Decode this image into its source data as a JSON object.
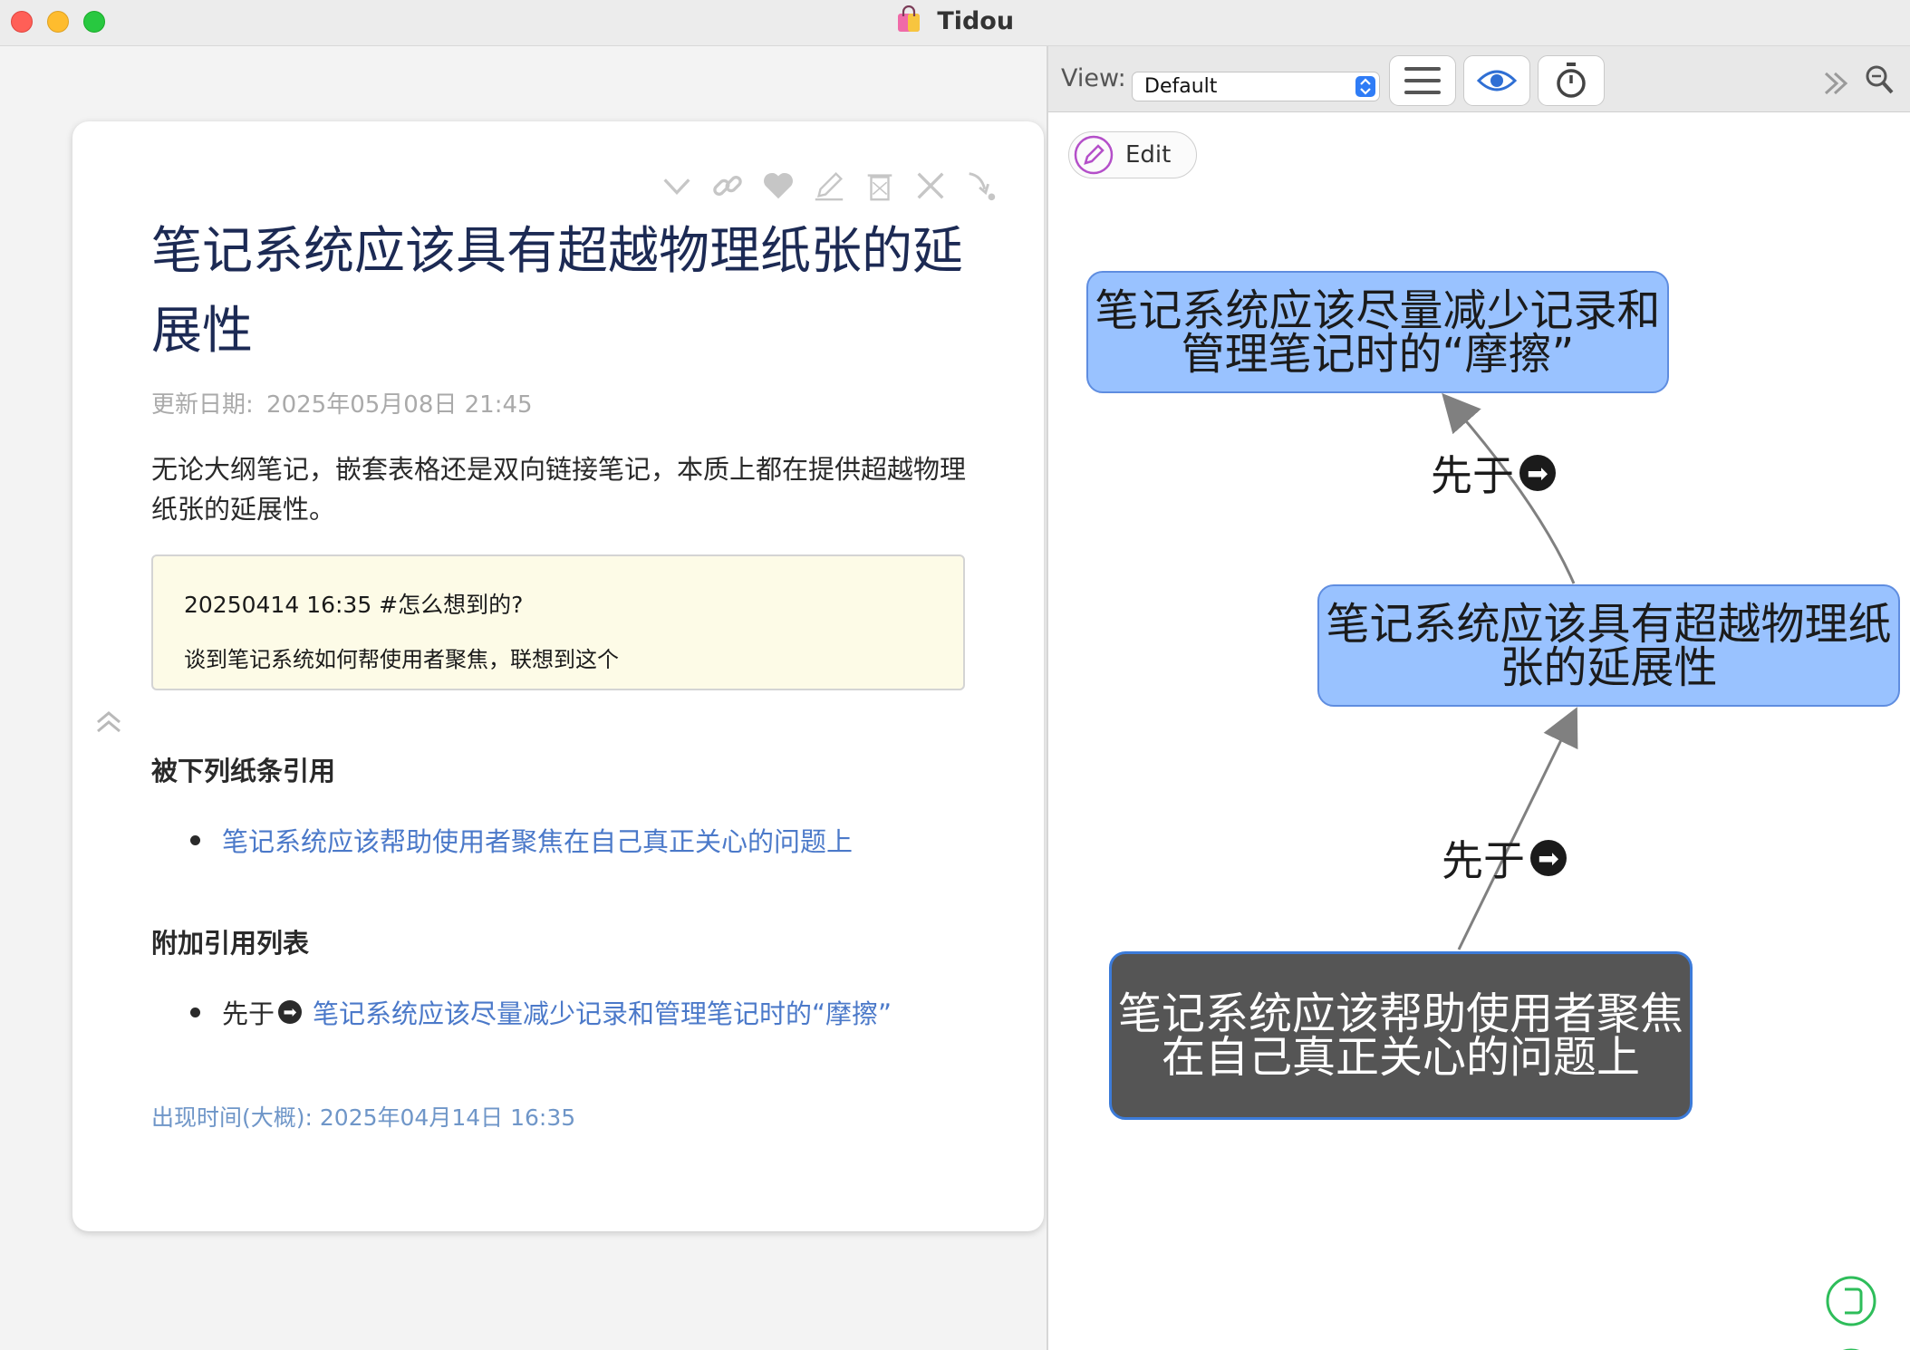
{
  "window": {
    "title": "Tidou"
  },
  "card": {
    "title": "笔记系统应该具有超越物理纸张的延展性",
    "updated_label": "更新日期:",
    "updated_value": "2025年05月08日 21:45",
    "body": "无论大纲笔记，嵌套表格还是双向链接笔记，本质上都在提供超越物理纸张的延展性。",
    "note": {
      "line1": "20250414 16:35 #怎么想到的?",
      "line2": "谈到笔记系统如何帮使用者聚焦，联想到这个"
    },
    "backlinks_heading": "被下列纸条引用",
    "backlinks": [
      {
        "text": "笔记系统应该帮助使用者聚焦在自己真正关心的问题上"
      }
    ],
    "extra_heading": "附加引用列表",
    "extra_refs": [
      {
        "relation": "先于",
        "arrow": "➡",
        "text": "笔记系统应该尽量减少记录和管理笔记时的“摩擦”"
      }
    ],
    "appeared_label": "出现时间(大概):",
    "appeared_value": "2025年04月14日 16:35"
  },
  "view": {
    "label": "View:",
    "selected": "Default"
  },
  "edit_button": {
    "label": "Edit"
  },
  "graph": {
    "nodes": [
      {
        "text": "笔记系统应该尽量减少记录和管理笔记时的“摩擦”"
      },
      {
        "text": "笔记系统应该具有超越物理纸张的延展性"
      },
      {
        "text": "笔记系统应该帮助使用者聚焦在自己真正关心的问题上"
      }
    ],
    "edges": [
      {
        "label": "先于",
        "arrow": "➡"
      },
      {
        "label": "先于",
        "arrow": "➡"
      }
    ]
  },
  "colors": {
    "node_blue": "#99c2ff",
    "node_dark": "#555555",
    "link": "#4b79c9",
    "title": "#1c2a54",
    "accent_green": "#2ebd5a",
    "accent_purple": "#b44fc9"
  }
}
